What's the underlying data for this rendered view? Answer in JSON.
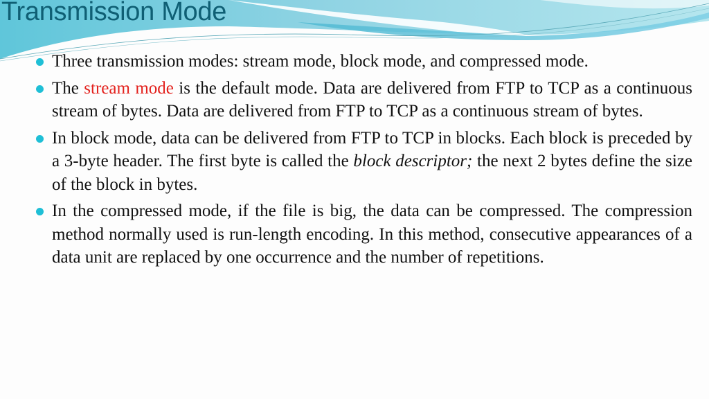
{
  "slide": {
    "title": "Transmission Mode",
    "accent_color": "#1fbfd6",
    "highlight_color": "#e3211d",
    "title_color": "#0f5f74",
    "bullets": [
      {
        "text": "Three  transmission modes: stream mode, block mode, and compressed mode."
      },
      {
        "pre": "The ",
        "highlight": "stream mode",
        "post": " is the default mode. Data are delivered from FTP to TCP as a continuous stream of bytes. Data are delivered from FTP to TCP as a continuous stream of bytes."
      },
      {
        "pre": "In block mode, data can be delivered from FTP to TCP in blocks. Each block is preceded by a 3-byte header. The first byte is called the ",
        "italic": "block descriptor;",
        "post": " the next 2 bytes define the size of the block in bytes."
      },
      {
        "text": "In the compressed mode, if the file is big, the data can be compressed. The compression method normally used is run-length encoding. In this method, consecutive appearances of a data unit are replaced by one occurrence and the number of repetitions."
      }
    ]
  }
}
